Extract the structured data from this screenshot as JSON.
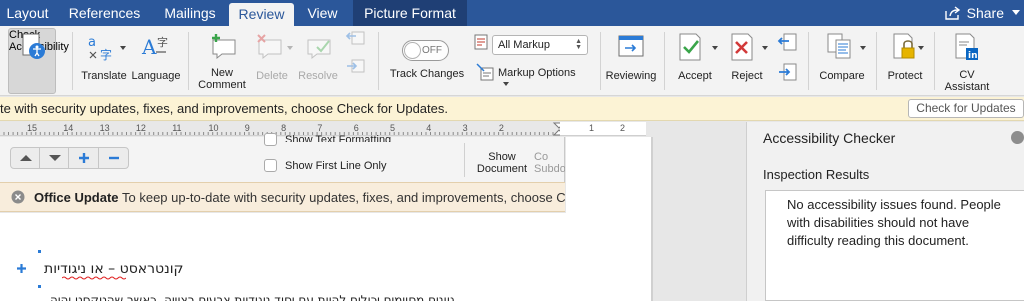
{
  "tabs": [
    {
      "label": "Layout"
    },
    {
      "label": "References"
    },
    {
      "label": "Mailings"
    },
    {
      "label": "Review"
    },
    {
      "label": "View"
    },
    {
      "label": "Picture Format"
    }
  ],
  "share_label": "Share",
  "ribbon": {
    "check_accessibility": [
      "Check",
      "Accessibility"
    ],
    "translate": "Translate",
    "language": "Language",
    "new_comment": [
      "New",
      "Comment"
    ],
    "delete": "Delete",
    "resolve": "Resolve",
    "track_changes": "Track Changes",
    "toggle_state": "OFF",
    "markup_display": "All Markup",
    "markup_options": "Markup Options",
    "reviewing": "Reviewing",
    "accept": "Accept",
    "reject": "Reject",
    "compare": "Compare",
    "protect": "Protect",
    "cv_assistant": [
      "CV",
      "Assistant"
    ]
  },
  "update_bar": {
    "message": "te with security updates, fixes, and improvements, choose Check for Updates.",
    "button": "Check for Updates"
  },
  "ruler": {
    "left_numbers": [
      "15",
      "14",
      "13",
      "12",
      "11",
      "10",
      "9",
      "8",
      "7",
      "6",
      "5",
      "4",
      "3",
      "2"
    ],
    "right_numbers": [
      "1",
      "2"
    ]
  },
  "inner_panel": {
    "show_text_formatting": "Show Text Formatting",
    "show_first_line": "Show First Line Only",
    "show_document": [
      "Show",
      "Document"
    ],
    "collapse": [
      "Co",
      "Subdo"
    ]
  },
  "office_update": {
    "title": "Office Update",
    "message": "To keep up-to-date with security updates, fixes, and improvements, choose Che"
  },
  "document": {
    "heading": "קונטראסט – או ניגודיות",
    "line2": "גוונים מסוימים יכולים להיות עם יסוד ניגודיות צבעים רצוייה. כאשר שהטקסט יהיה"
  },
  "pane": {
    "title": "Accessibility Checker",
    "subtitle": "Inspection Results",
    "result": "No accessibility issues found. People with disabilities should not have difficulty reading this document."
  },
  "colors": {
    "ribbon_tab_bar": "#2b579a",
    "contextual_tab": "#1f3f75",
    "update_bar": "#fcf3d5",
    "accept_check": "#3aa54a",
    "reject_x": "#d23a3a",
    "accent_blue": "#2b7bd6"
  }
}
